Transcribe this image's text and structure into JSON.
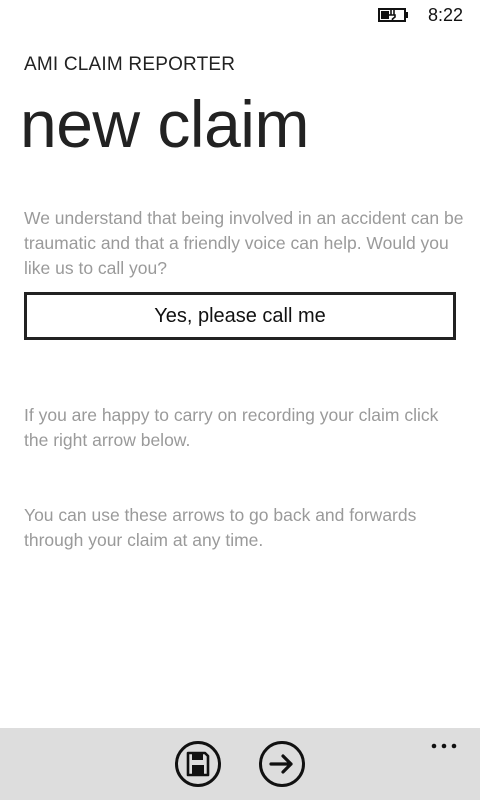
{
  "status_bar": {
    "battery_icon": "battery-charging-icon",
    "time": "8:22"
  },
  "app": {
    "title": "AMI CLAIM REPORTER",
    "page_title": "new claim"
  },
  "content": {
    "intro_text": "We understand that being involved in an accident can be traumatic and that a friendly voice can help. Would you like us to call you?",
    "call_button_label": "Yes, please call me",
    "carry_on_text": "If you are happy to carry on recording your claim click the right arrow below.",
    "arrows_text": "You can use these arrows to go back and forwards through your claim at any time."
  },
  "app_bar": {
    "buttons": [
      {
        "icon": "save-icon"
      },
      {
        "icon": "arrow-right-icon"
      }
    ],
    "more_icon": "ellipsis-icon"
  }
}
